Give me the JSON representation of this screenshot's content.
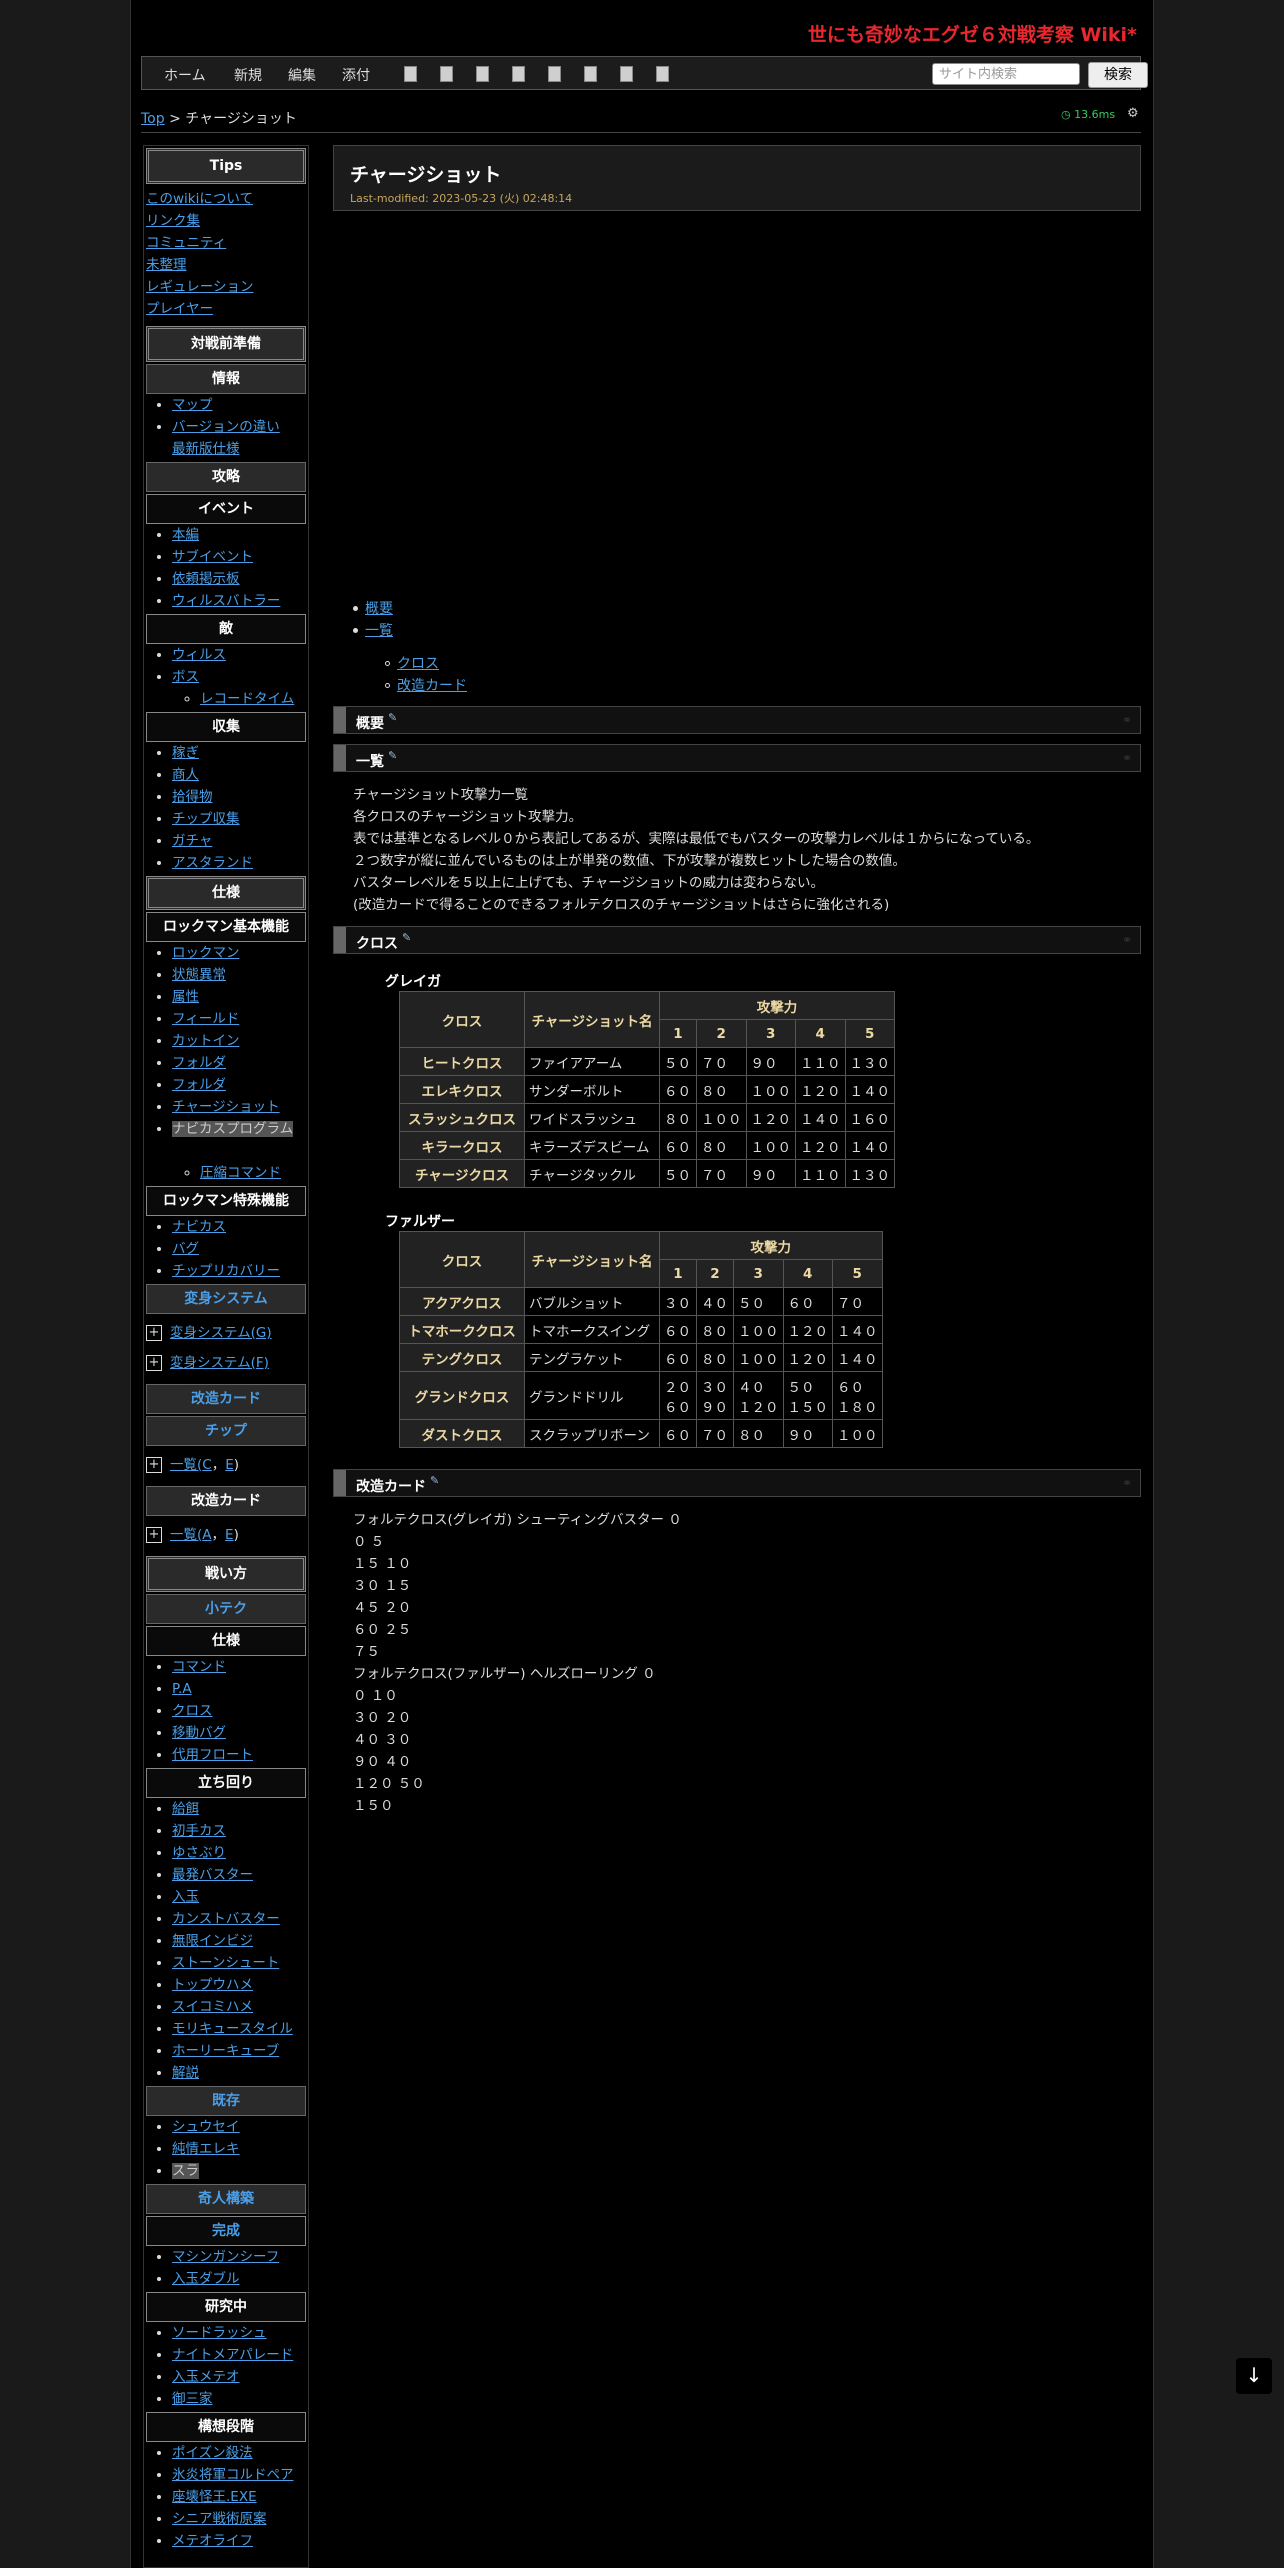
{
  "site_title": "世にも奇妙なエグゼ６対戦考察 Wiki*",
  "menu": {
    "items": [
      "ホーム",
      "新規",
      "編集",
      "添付"
    ],
    "search_placeholder": "サイト内検索",
    "search_button": "検索"
  },
  "breadcrumb": {
    "top": "Top",
    "sep": " > ",
    "current": "チャージショット"
  },
  "perf": "13.6ms",
  "page": {
    "title": "チャージショット",
    "last_modified": "Last-modified: 2023-05-23 (火) 02:48:14"
  },
  "sidebar": {
    "tips_heading": "Tips",
    "tips_links": [
      "このwikiについて",
      "リンク集",
      "コミュニティ",
      "未整理",
      "レギュレーション",
      "プレイヤー"
    ],
    "prep_heading": "対戦前準備",
    "info_heading": "情報",
    "info_links": [
      "マップ",
      "バージョンの違い",
      "最新版仕様"
    ],
    "strategy_heading": "攻略",
    "event_heading": "イベント",
    "event_links": [
      "本編",
      "サブイベント",
      "依頼掲示板",
      "ウィルスバトラー"
    ],
    "enemy_heading": "敵",
    "enemy_links": [
      "ウィルス",
      "ボス"
    ],
    "enemy_sub": [
      "レコードタイム"
    ],
    "collect_heading": "収集",
    "collect_links": [
      "稼ぎ",
      "商人",
      "拾得物",
      "チップ収集",
      "ガチャ",
      "アスタランド"
    ],
    "spec_heading": "仕様",
    "rockman_basic_heading": "ロックマン基本機能",
    "rockman_basic_links": [
      "ロックマン",
      "状態異常",
      "属性",
      "フィールド",
      "カットイン",
      "フォルダ",
      "フォルダ",
      "チャージショット",
      "ナビカスプログラム"
    ],
    "rockman_basic_sub": [
      "圧縮コマンド"
    ],
    "rockman_special_heading": "ロックマン特殊機能",
    "rockman_special_links": [
      "ナビカス",
      "バグ",
      "チップリカバリー"
    ],
    "transform_heading": "変身システム",
    "transform_items": [
      "変身システム(G)",
      "変身システム(F)"
    ],
    "kaizo_heading1": "改造カード",
    "chip_heading": "チップ",
    "chip_item_prefix": "一覧(",
    "chip_item_a": "C",
    "chip_item_sep": "，",
    "chip_item_b": "E",
    "chip_item_suffix": ")",
    "kaizo_heading2": "改造カード",
    "kaizo_item_a": "A",
    "kaizo_item_b": "E",
    "tactics_heading": "戦い方",
    "technique_heading": "小テク",
    "spec2_heading": "仕様",
    "spec2_links": [
      "コマンド",
      "P.A",
      "クロス",
      "移動バグ",
      "代用フロート"
    ],
    "movement_heading": "立ち回り",
    "movement_links": [
      "給餌",
      "初手カス",
      "ゆさぶり",
      "最発バスター",
      "入玉",
      "カンストバスター",
      "無限インビジ",
      "ストーンシュート",
      "トップウハメ",
      "スイコミハメ",
      "モリキュースタイル",
      "ホーリーキューブ",
      "解説"
    ],
    "existing_heading": "既存",
    "existing_links": [
      "シュウセイ",
      "純情エレキ",
      "スラ"
    ],
    "build_heading": "奇人構築",
    "done_heading": "完成",
    "done_links": [
      "マシンガンシーフ",
      "入玉ダブル"
    ],
    "research_heading": "研究中",
    "research_links": [
      "ソードラッシュ",
      "ナイトメアパレード",
      "入玉メテオ",
      "御三家"
    ],
    "concept_heading": "構想段階",
    "concept_links": [
      "ポイズン殺法",
      "氷炎将軍コルドペア",
      "座壊怪王.EXE",
      "シニア戦術原案",
      "メテオライフ"
    ]
  },
  "toc": {
    "items": [
      "概要",
      "一覧"
    ],
    "sub_items": [
      "クロス",
      "改造カード"
    ]
  },
  "sections": {
    "overview": "概要",
    "list": "一覧",
    "cross": "クロス",
    "kaizo": "改造カード"
  },
  "intro_lines": [
    "チャージショット攻撃力一覧",
    "各クロスのチャージショット攻撃力。",
    "表では基準となるレベル０から表記してあるが、実際は最低でもバスターの攻撃力レベルは１からになっている。",
    "２つ数字が縦に並んでいるものは上が単発の数値、下が攻撃が複数ヒットした場合の数値。",
    "バスターレベルを５以上に上げても、チャージショットの威力は変わらない。",
    "(改造カードで得ることのできるフォルテクロスのチャージショットはさらに強化される)"
  ],
  "tables": {
    "col_cross": "クロス",
    "col_name": "チャージショット名",
    "col_attack": "攻撃力",
    "levels": [
      "1",
      "2",
      "3",
      "4",
      "5"
    ],
    "gregar_label": "グレイガ",
    "gregar_rows": [
      {
        "cross": "ヒートクロス",
        "name": "ファイアアーム",
        "v": [
          "５０",
          "７０",
          "９０",
          "１１０",
          "１３０"
        ]
      },
      {
        "cross": "エレキクロス",
        "name": "サンダーボルト",
        "v": [
          "６０",
          "８０",
          "１００",
          "１２０",
          "１４０"
        ]
      },
      {
        "cross": "スラッシュクロス",
        "name": "ワイドスラッシュ",
        "v": [
          "８０",
          "１００",
          "１２０",
          "１４０",
          "１６０"
        ]
      },
      {
        "cross": "キラークロス",
        "name": "キラーズデスビーム",
        "v": [
          "６０",
          "８０",
          "１００",
          "１２０",
          "１４０"
        ]
      },
      {
        "cross": "チャージクロス",
        "name": "チャージタックル",
        "v": [
          "５０",
          "７０",
          "９０",
          "１１０",
          "１３０"
        ]
      }
    ],
    "falzar_label": "ファルザー",
    "falzar_rows": [
      {
        "cross": "アクアクロス",
        "name": "バブルショット",
        "v": [
          "３０",
          "４０",
          "５０",
          "６０",
          "７０"
        ]
      },
      {
        "cross": "トマホーククロス",
        "name": "トマホークスイング",
        "v": [
          "６０",
          "８０",
          "１００",
          "１２０",
          "１４０"
        ]
      },
      {
        "cross": "テングクロス",
        "name": "テングラケット",
        "v": [
          "６０",
          "８０",
          "１００",
          "１２０",
          "１４０"
        ]
      },
      {
        "cross": "グランドクロス",
        "name": "グランドドリル",
        "v": [
          "２０",
          "３０",
          "４０",
          "５０",
          "６０"
        ],
        "v2": [
          "６０",
          "９０",
          "１２０",
          "１５０",
          "１８０"
        ]
      },
      {
        "cross": "ダストクロス",
        "name": "スクラップリボーン",
        "v": [
          "６０",
          "７０",
          "８０",
          "９０",
          "１００"
        ]
      }
    ]
  },
  "kaizo_lines": [
    "フォルテクロス(グレイガ) シューティングバスター ０",
    "０ ５",
    "１５ １０",
    "３０ １５",
    "４５ ２０",
    "６０ ２５",
    "７５",
    "フォルテクロス(ファルザー) ヘルズローリング ０",
    "０ １０",
    "３０ ２０",
    "４０ ３０",
    "９０ ４０",
    "１２０ ５０",
    "１５０"
  ]
}
